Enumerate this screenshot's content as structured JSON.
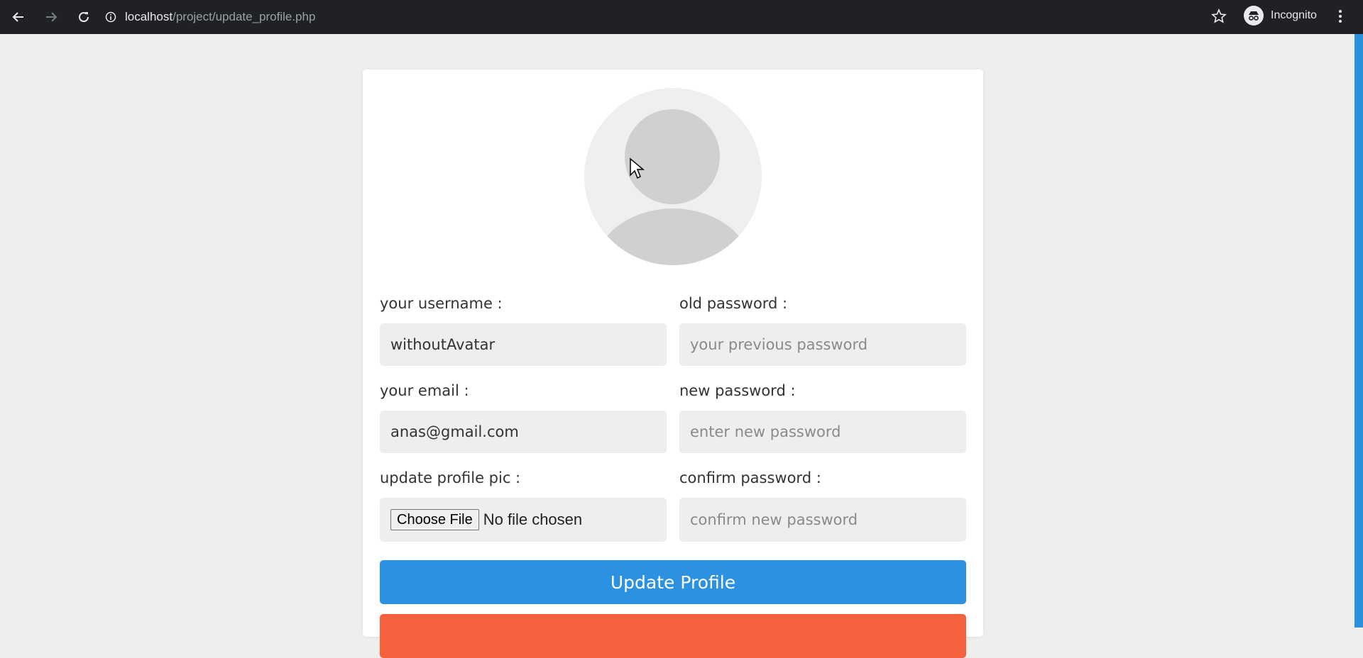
{
  "browser": {
    "url_host": "localhost",
    "url_path": "/project/update_profile.php",
    "profile_label": "Incognito"
  },
  "form": {
    "username_label": "your username :",
    "username_value": "withoutAvatar",
    "old_password_label": "old password :",
    "old_password_placeholder": "your previous password",
    "email_label": "your email :",
    "email_value": "anas@gmail.com",
    "new_password_label": "new password :",
    "new_password_placeholder": "enter new password",
    "pic_label": "update profile pic :",
    "file_button_label": "Choose File",
    "file_status": "No file chosen",
    "confirm_password_label": "confirm password :",
    "confirm_password_placeholder": "confirm new password",
    "update_button_label": "Update Profile"
  },
  "colors": {
    "primary_button": "#2b91e0",
    "secondary_button": "#f5613c",
    "page_bg": "#eeeeec",
    "card_bg": "#ffffff"
  },
  "icons": [
    "back-arrow-icon",
    "forward-arrow-icon",
    "reload-icon",
    "info-icon",
    "star-icon",
    "incognito-icon",
    "menu-dots-icon",
    "avatar-placeholder-icon"
  ]
}
